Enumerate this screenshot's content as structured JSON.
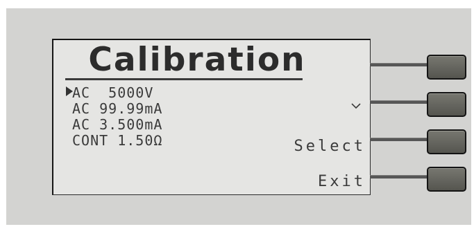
{
  "screen": {
    "title": "Calibration",
    "menu": [
      {
        "label": "AC  5000V",
        "selected": true
      },
      {
        "label": "AC 99.99mA",
        "selected": false
      },
      {
        "label": "AC 3.500mA",
        "selected": false
      },
      {
        "label": "CONT 1.50Ω",
        "selected": false
      }
    ],
    "softkeys": [
      {
        "label": "",
        "icon": "chevron-down-icon"
      },
      {
        "label": "Select"
      },
      {
        "label": "Exit"
      }
    ]
  },
  "colors": {
    "panel": "#d3d3d1",
    "lcd_background": "#e5e5e3",
    "lcd_text": "#2c2c2c",
    "button": "#66665f"
  }
}
